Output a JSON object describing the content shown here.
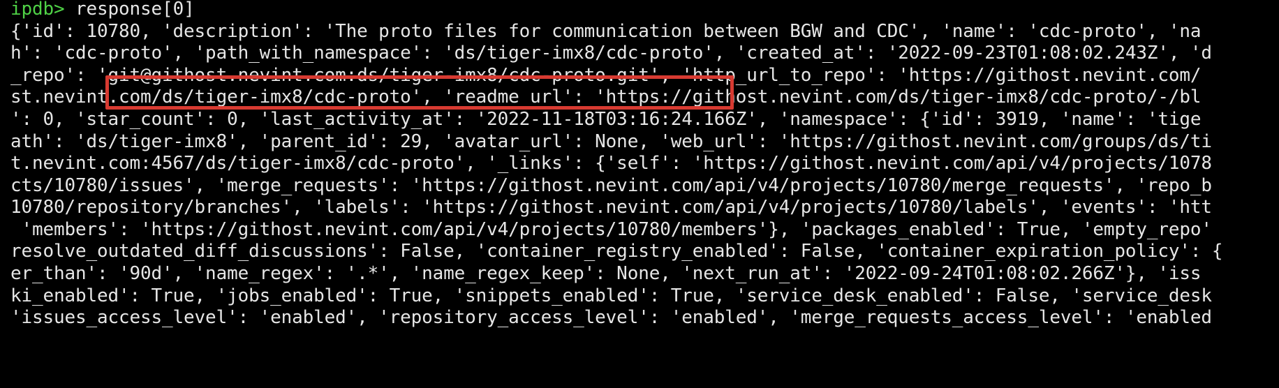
{
  "terminal": {
    "prompt": "ipdb>",
    "command": " response[0]",
    "lines": [
      "{'id': 10780, 'description': 'The proto files for communication between BGW and CDC', 'name': 'cdc-proto', 'na",
      "h': 'cdc-proto', 'path_with_namespace': 'ds/tiger-imx8/cdc-proto', 'created_at': '2022-09-23T01:08:02.243Z', 'd",
      "_repo': 'git@githost.nevint.com:ds/tiger-imx8/cdc-proto.git', 'http_url_to_repo': 'https://githost.nevint.com/",
      "st.nevint.com/ds/tiger-imx8/cdc-proto', 'readme_url': 'https://githost.nevint.com/ds/tiger-imx8/cdc-proto/-/bl",
      "': 0, 'star_count': 0, 'last_activity_at': '2022-11-18T03:16:24.166Z', 'namespace': {'id': 3919, 'name': 'tige",
      "ath': 'ds/tiger-imx8', 'parent_id': 29, 'avatar_url': None, 'web_url': 'https://githost.nevint.com/groups/ds/ti",
      "t.nevint.com:4567/ds/tiger-imx8/cdc-proto', '_links': {'self': 'https://githost.nevint.com/api/v4/projects/1078",
      "cts/10780/issues', 'merge_requests': 'https://githost.nevint.com/api/v4/projects/10780/merge_requests', 'repo_b",
      "10780/repository/branches', 'labels': 'https://githost.nevint.com/api/v4/projects/10780/labels', 'events': 'htt",
      " 'members': 'https://githost.nevint.com/api/v4/projects/10780/members'}, 'packages_enabled': True, 'empty_repo'",
      "resolve_outdated_diff_discussions': False, 'container_registry_enabled': False, 'container_expiration_policy': {",
      "er_than': '90d', 'name_regex': '.*', 'name_regex_keep': None, 'next_run_at': '2022-09-24T01:08:02.266Z'}, 'iss",
      "ki_enabled': True, 'jobs_enabled': True, 'snippets_enabled': True, 'service_desk_enabled': False, 'service_desk",
      "'issues_access_level': 'enabled', 'repository_access_level': 'enabled', 'merge_requests_access_level': 'enabled"
    ]
  },
  "colors": {
    "background": "#000000",
    "text": "#e6e6e6",
    "prompt": "#4fd146",
    "highlight": "#d73a31"
  }
}
